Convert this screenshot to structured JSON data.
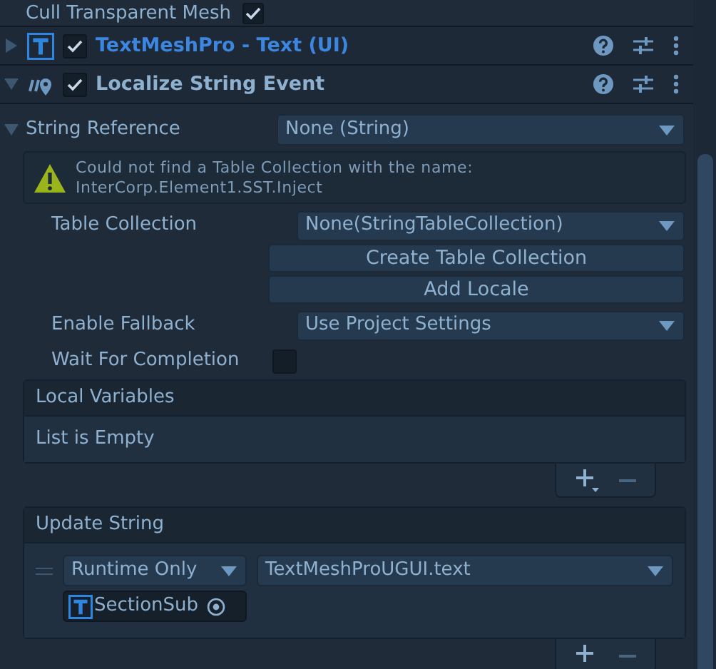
{
  "top_field": {
    "label": "Cull Transparent Mesh",
    "checked": true
  },
  "components": [
    {
      "kind": "tmp",
      "title": "TextMeshPro - Text (UI)",
      "expanded": false,
      "enabled": true,
      "highlighted": true
    },
    {
      "kind": "localize",
      "title": "Localize String Event",
      "expanded": true,
      "enabled": true,
      "highlighted": false
    }
  ],
  "string_reference": {
    "label": "String Reference",
    "expanded": true,
    "value": "None (String)"
  },
  "warning": {
    "lines": [
      "Could not find a Table Collection with the name:",
      "InterCorp.Element1.SST.Inject"
    ]
  },
  "table_collection": {
    "label": "Table Collection",
    "value": "None(StringTableCollection)"
  },
  "buttons": [
    "Create Table Collection",
    "Add Locale"
  ],
  "enable_fallback": {
    "label": "Enable Fallback",
    "value": "Use Project Settings"
  },
  "wait_for_completion": {
    "label": "Wait For Completion",
    "checked": false
  },
  "local_variables": {
    "title": "Local Variables",
    "empty_text": "List is Empty"
  },
  "update_string": {
    "title": "Update String",
    "mode": "Runtime Only",
    "function": "TextMeshProUGUI.text",
    "target": "SectionSub"
  }
}
